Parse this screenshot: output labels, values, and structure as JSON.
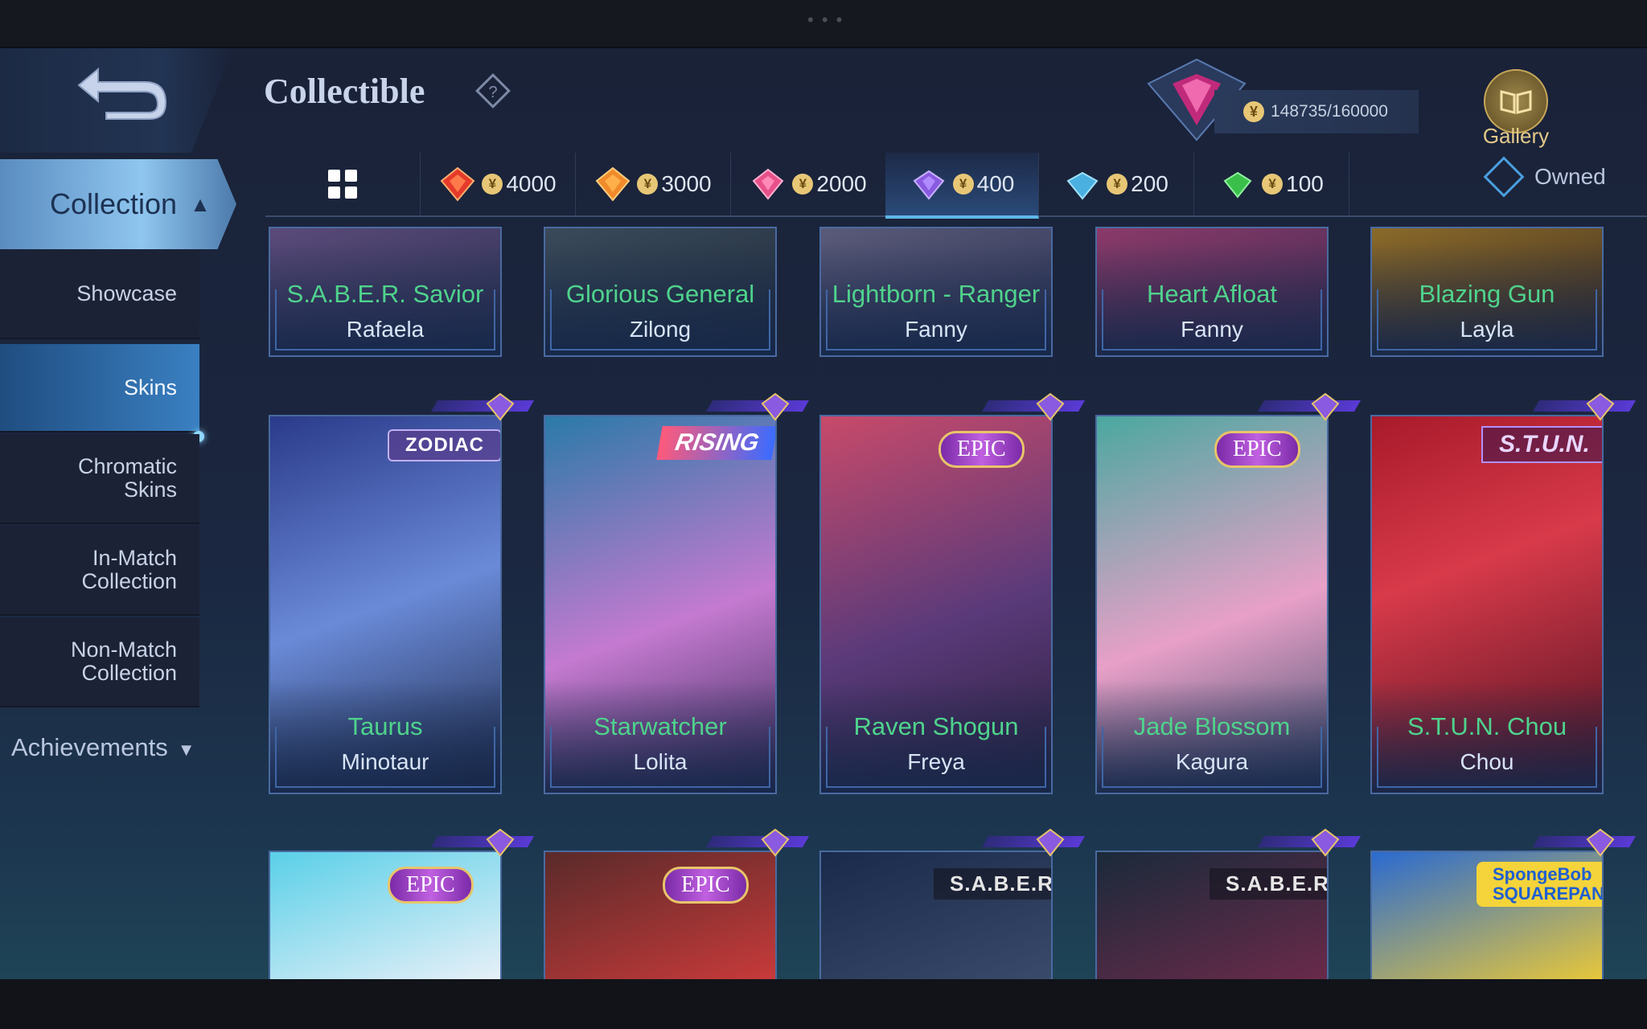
{
  "header": {
    "title": "Collectible",
    "currency": "148735/160000",
    "gallery_label": "Gallery"
  },
  "tabs": [
    {
      "name": "tab-all",
      "label": "",
      "icon": "grid-icon"
    },
    {
      "name": "tab-4000",
      "label": "4000",
      "gem_color": "#e53a2a"
    },
    {
      "name": "tab-3000",
      "label": "3000",
      "gem_color": "#f08a2a"
    },
    {
      "name": "tab-2000",
      "label": "2000",
      "gem_color": "#e8508a"
    },
    {
      "name": "tab-400",
      "label": "400",
      "gem_color": "#8a5ae0",
      "active": true
    },
    {
      "name": "tab-200",
      "label": "200",
      "gem_color": "#4ab0e0"
    },
    {
      "name": "tab-100",
      "label": "100",
      "gem_color": "#3ac04a"
    }
  ],
  "owned_label": "Owned",
  "sidebar": {
    "collection": "Collection",
    "items": [
      {
        "label": "Showcase"
      },
      {
        "label": "Skins",
        "active": true
      },
      {
        "label": "Chromatic\nSkins"
      },
      {
        "label": "In-Match\nCollection"
      },
      {
        "label": "Non-Match\nCollection"
      }
    ],
    "achievements": "Achievements"
  },
  "cards_row1": [
    {
      "skin": "S.A.B.E.R. Savior",
      "hero": "Rafaela",
      "tint": "#5a4a7a"
    },
    {
      "skin": "Glorious General",
      "hero": "Zilong",
      "tint": "#3a4a5a"
    },
    {
      "skin": "Lightborn - Ranger",
      "hero": "Fanny",
      "tint": "#5a5a7a"
    },
    {
      "skin": "Heart Afloat",
      "hero": "Fanny",
      "tint": "#8a3a6a"
    },
    {
      "skin": "Blazing Gun",
      "hero": "Layla",
      "tint": "#8a6a2a"
    }
  ],
  "cards_row2": [
    {
      "skin": "Taurus",
      "hero": "Minotaur",
      "tag": "ZODIAC",
      "tag_type": "zodiac",
      "tint1": "#2a3a8a",
      "tint2": "#6a8ad8"
    },
    {
      "skin": "Starwatcher",
      "hero": "Lolita",
      "tag": "RISING",
      "tag_type": "rising",
      "tint1": "#2a7aa8",
      "tint2": "#c47ad0"
    },
    {
      "skin": "Raven Shogun",
      "hero": "Freya",
      "tag": "EPIC",
      "tag_type": "epic",
      "tint1": "#c84a6a",
      "tint2": "#5a3a7a"
    },
    {
      "skin": "Jade Blossom",
      "hero": "Kagura",
      "tag": "EPIC",
      "tag_type": "epic",
      "tint1": "#4aa8a0",
      "tint2": "#e8a0c8"
    },
    {
      "skin": "S.T.U.N. Chou",
      "hero": "Chou",
      "tag": "S.T.U.N.",
      "tag_type": "stun",
      "tint1": "#a81a2a",
      "tint2": "#4a1020"
    }
  ],
  "cards_row3": [
    {
      "tag": "EPIC",
      "tag_type": "epic",
      "tint1": "#5ad0e8",
      "tint2": "#e8f0f8"
    },
    {
      "tag": "EPIC",
      "tag_type": "epic",
      "tint1": "#5a2a2a",
      "tint2": "#c83a3a"
    },
    {
      "tag": "S.A.B.E.R.",
      "tag_type": "saber",
      "tint1": "#1a2a4a",
      "tint2": "#3a4a6a"
    },
    {
      "tag": "S.A.B.E.R.",
      "tag_type": "saber",
      "tint1": "#1a2a3a",
      "tint2": "#6a2a4a"
    },
    {
      "tag": "SpongeBob\nSQUAREPANTS",
      "tag_type": "sponge",
      "tint1": "#2a6ad0",
      "tint2": "#e8c83a"
    }
  ]
}
